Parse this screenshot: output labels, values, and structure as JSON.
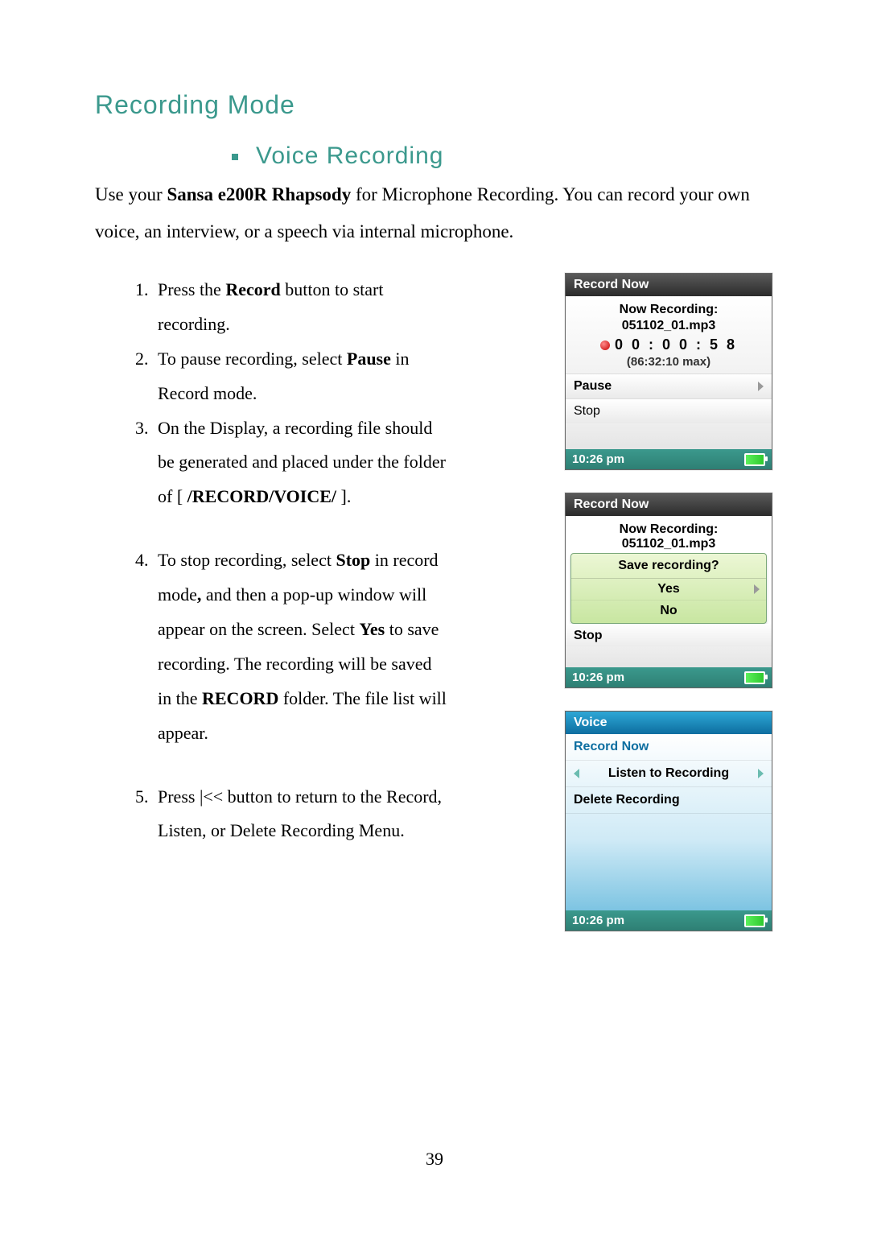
{
  "page": {
    "section_title": "Recording Mode",
    "sub_title": "Voice Recording",
    "intro_prefix": "Use your ",
    "intro_bold": "Sansa e200R Rhapsody",
    "intro_suffix": " for Microphone Recording.    You can record your own voice, an interview, or a speech via internal microphone.",
    "page_number": "39"
  },
  "steps": {
    "s1_a": "Press the ",
    "s1_b": "Record",
    "s1_c": " button to start recording.",
    "s2_a": "To pause recording, select ",
    "s2_b": "Pause",
    "s2_c": " in Record mode.",
    "s3_a": "On the Display, a recording file should be generated and placed under the folder of [ ",
    "s3_b": "/RECORD/VOICE/",
    "s3_c": " ].",
    "s4_a": "To stop recording, select ",
    "s4_b": "Stop",
    "s4_c": " in record mode",
    "s4_d": ",",
    "s4_e": " and then a pop-up window will appear on the screen. Select ",
    "s4_f": "Yes",
    "s4_g": " to save recording. The recording will be saved in the ",
    "s4_h": "RECORD",
    "s4_i": " folder. The file list will appear.",
    "s5": "Press |<< button to return to the Record, Listen, or Delete Recording Menu."
  },
  "screen1": {
    "title": "Record Now",
    "status": "Now Recording:",
    "file": "051102_01.mp3",
    "time": "0 0 : 0 0 : 5 8",
    "max": "(86:32:10 max)",
    "pause": "Pause",
    "stop": "Stop",
    "clock": "10:26 pm"
  },
  "screen2": {
    "title": "Record Now",
    "status": "Now Recording:",
    "file": "051102_01.mp3",
    "question": "Save recording?",
    "yes": "Yes",
    "no": "No",
    "stop": "Stop",
    "clock": "10:26 pm"
  },
  "screen3": {
    "title": "Voice",
    "item1": "Record Now",
    "item2": "Listen to Recording",
    "item3": "Delete Recording",
    "clock": "10:26 pm"
  }
}
